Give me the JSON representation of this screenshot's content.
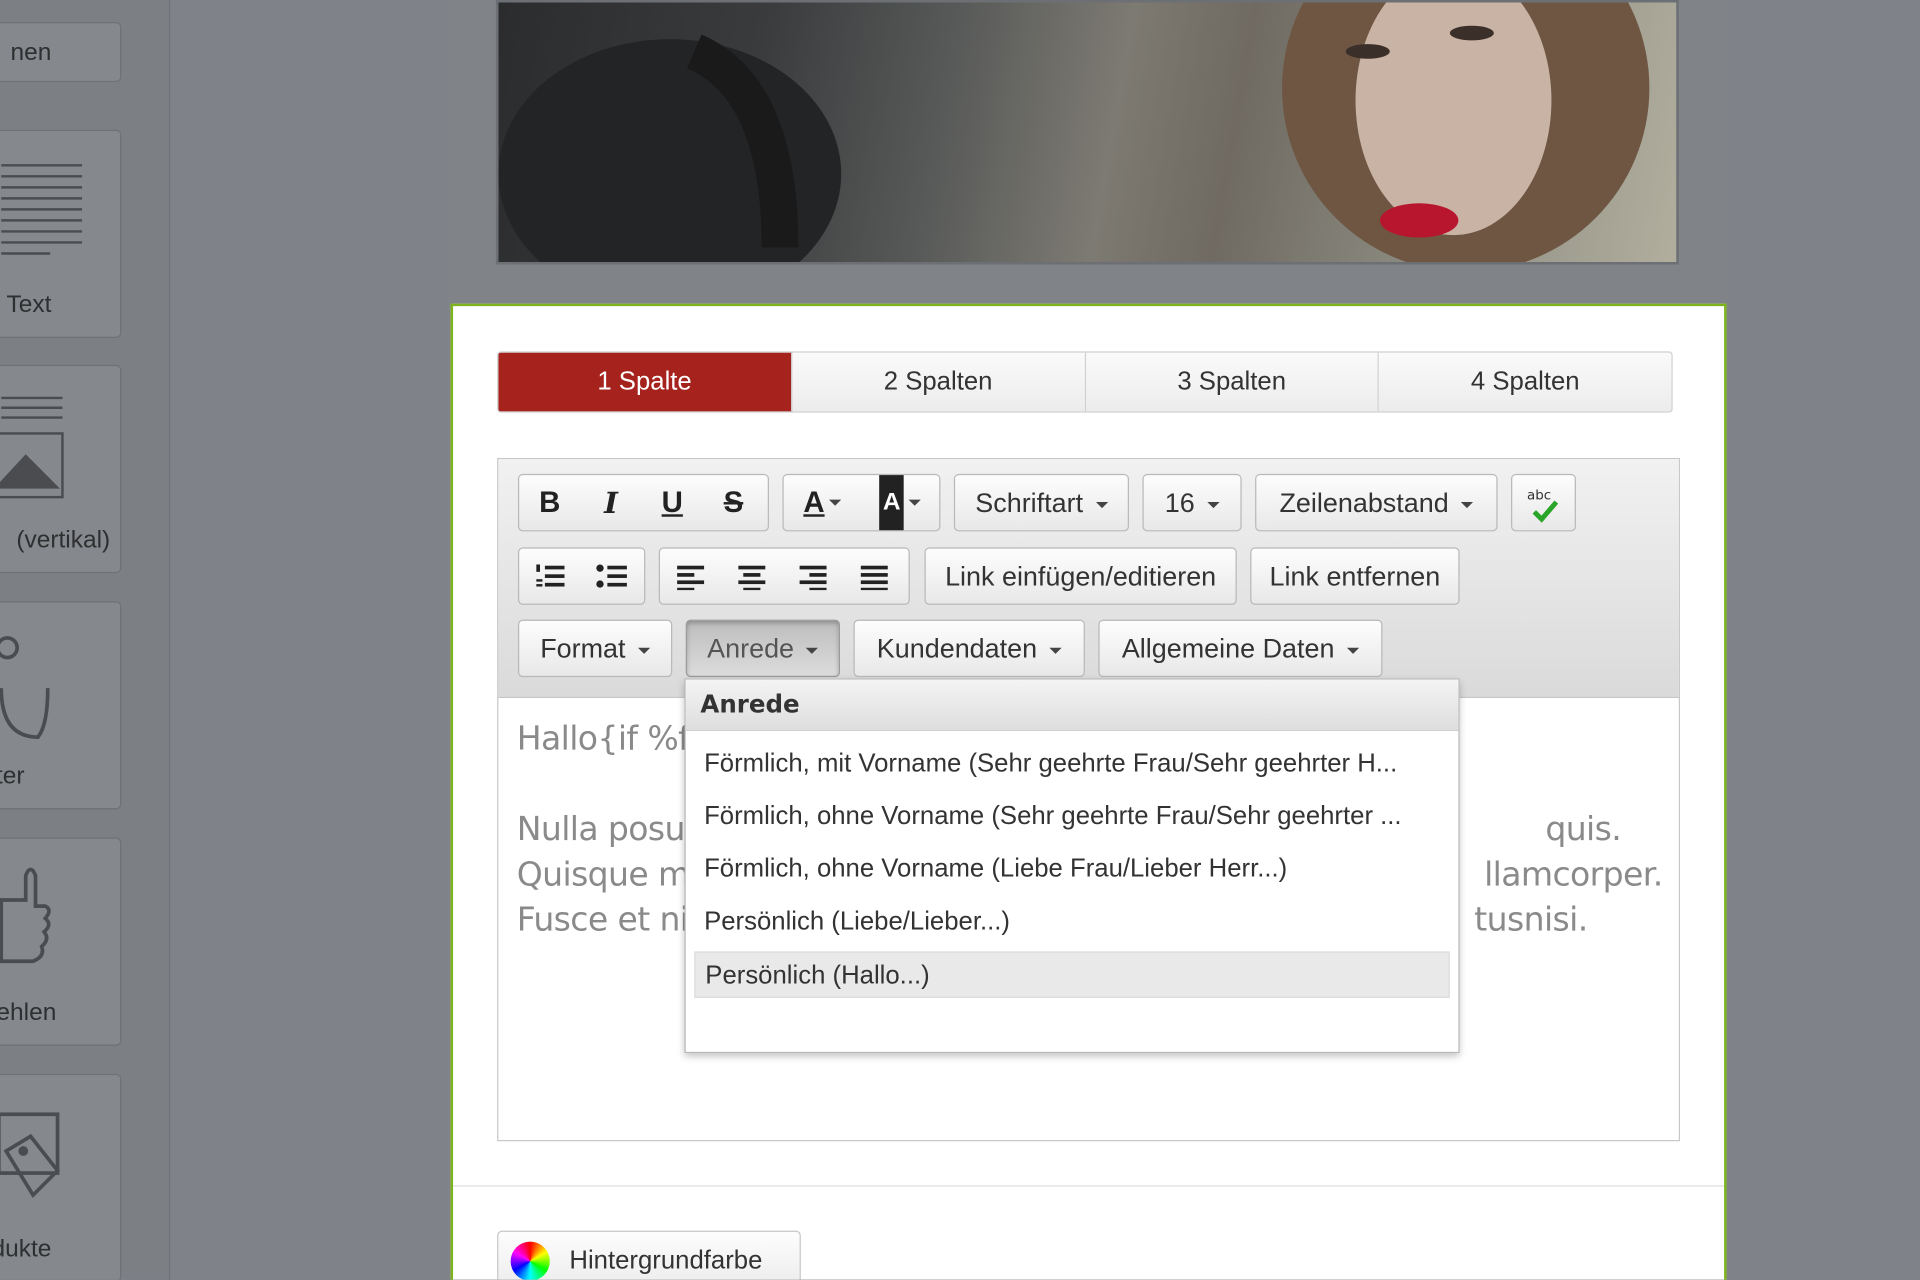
{
  "sidebar": {
    "top_button_label": "nen",
    "tiles": [
      {
        "label": "Text",
        "icon": "text-lines-icon"
      },
      {
        "label": "(vertikal)",
        "icon": "image-text-icon"
      },
      {
        "label": "ter",
        "icon": "footer-icon"
      },
      {
        "label": "ehlen",
        "icon": "thumbs-up-icon"
      },
      {
        "label": "dukte",
        "icon": "price-tag-icon"
      }
    ]
  },
  "tabs": [
    "1 Spalte",
    "2 Spalten",
    "3 Spalten",
    "4 Spalten"
  ],
  "active_tab": "1 Spalte",
  "toolbar": {
    "bold": "B",
    "italic": "I",
    "underline": "U",
    "strike": "S",
    "font_color": "A",
    "bg_color": "A",
    "font_family": "Schriftart",
    "font_size": "16",
    "line_height": "Zeilenabstand",
    "spellcheck_icon": "spellcheck-icon",
    "link_insert": "Link einfügen/editieren",
    "link_remove": "Link entfernen",
    "format": "Format",
    "anrede": "Anrede",
    "kundendaten": "Kundendaten",
    "allgemeine_daten": "Allgemeine Daten"
  },
  "editor_content": {
    "greeting": "Hallo{if %f",
    "line1_left": "Nulla posue",
    "line1_right": "quis.",
    "line2_left": "Quisque m",
    "line2_right": "llamcorper.",
    "line3_left": "Fusce et ni",
    "line3_right": "tusnisi."
  },
  "dropdown": {
    "header": "Anrede",
    "items": [
      "Förmlich, mit Vorname (Sehr geehrte Frau/Sehr geehrter H...",
      "Förmlich, ohne Vorname (Sehr geehrte Frau/Sehr geehrter ...",
      "Förmlich, ohne Vorname (Liebe Frau/Lieber Herr...)",
      "Persönlich (Liebe/Lieber...)",
      "Persönlich (Hallo...)"
    ],
    "highlighted_index": 4
  },
  "background_button": "Hintergrundfarbe",
  "colors": {
    "active_tab": "#a5221d",
    "panel_border": "#7db41c",
    "overlay": "#7f8389"
  }
}
